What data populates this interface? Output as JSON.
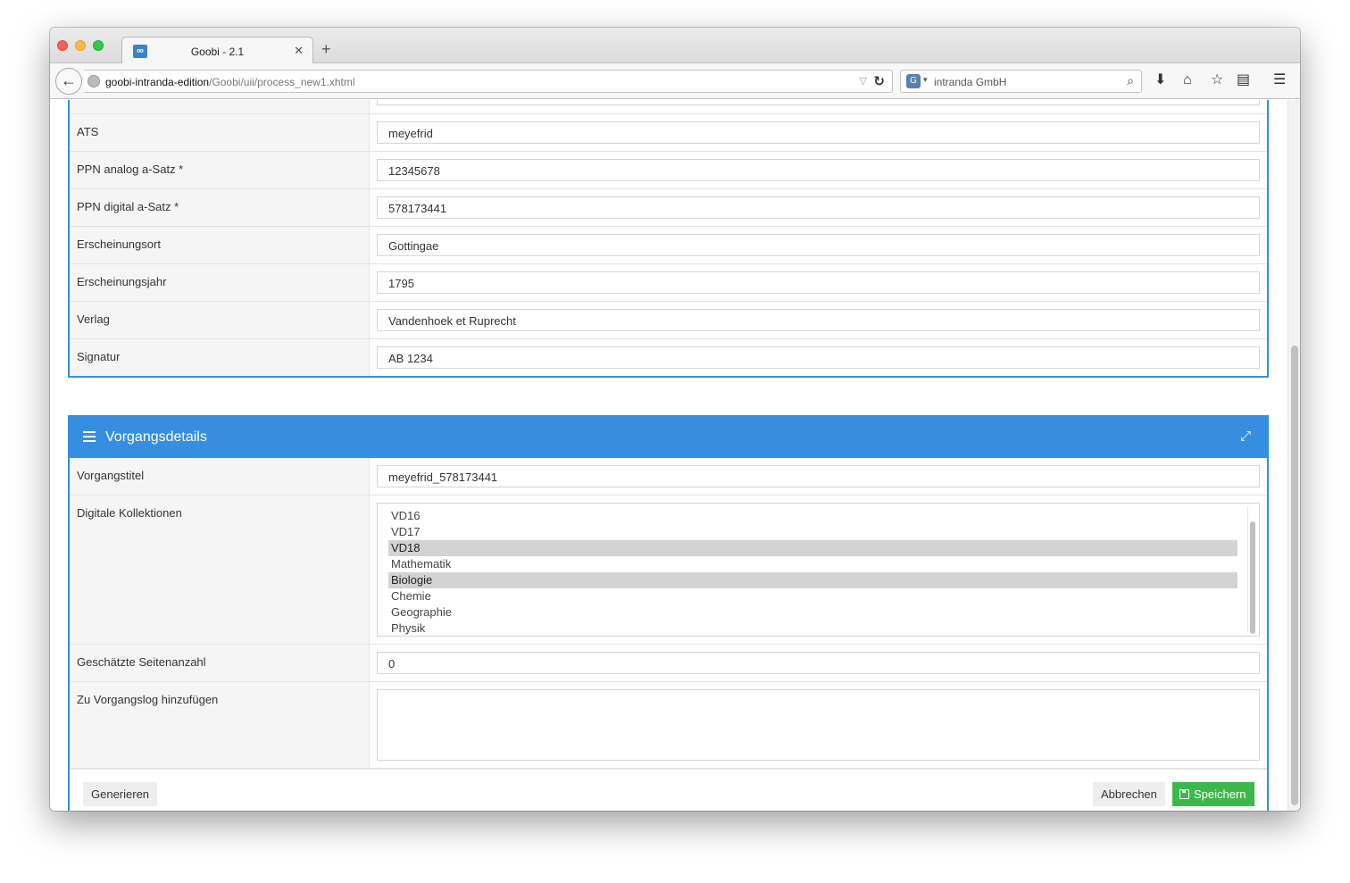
{
  "browser": {
    "tab_title": "Goobi - 2.1",
    "tab_favicon": "∞",
    "url_host": "goobi-intranda-edition",
    "url_path": "/Goobi/uii/process_new1.xhtml",
    "search_text": "intranda GmbH"
  },
  "metadata_rows": [
    {
      "label": "ATS",
      "value": "meyefrid"
    },
    {
      "label": "PPN analog a-Satz *",
      "value": "12345678"
    },
    {
      "label": "PPN digital a-Satz *",
      "value": "578173441"
    },
    {
      "label": "Erscheinungsort",
      "value": "Gottingae"
    },
    {
      "label": "Erscheinungsjahr",
      "value": "1795"
    },
    {
      "label": "Verlag",
      "value": "Vandenhoek et Ruprecht"
    },
    {
      "label": "Signatur",
      "value": "AB 1234"
    }
  ],
  "process_panel": {
    "title": "Vorgangsdetails",
    "title_label": "Vorgangstitel",
    "title_value": "meyefrid_578173441",
    "collections_label": "Digitale Kollektionen",
    "collections": [
      {
        "name": "VD16",
        "selected": false
      },
      {
        "name": "VD17",
        "selected": false
      },
      {
        "name": "VD18",
        "selected": true
      },
      {
        "name": "Mathematik",
        "selected": false
      },
      {
        "name": "Biologie",
        "selected": true
      },
      {
        "name": "Chemie",
        "selected": false
      },
      {
        "name": "Geographie",
        "selected": false
      },
      {
        "name": "Physik",
        "selected": false
      }
    ],
    "pages_label": "Geschätzte Seitenanzahl",
    "pages_value": "0",
    "log_label": "Zu Vorgangslog hinzufügen",
    "log_value": ""
  },
  "actions": {
    "generate": "Generieren",
    "cancel": "Abbrechen",
    "save": "Speichern"
  },
  "colors": {
    "accent": "#368ee0",
    "save": "#3cb84a"
  }
}
